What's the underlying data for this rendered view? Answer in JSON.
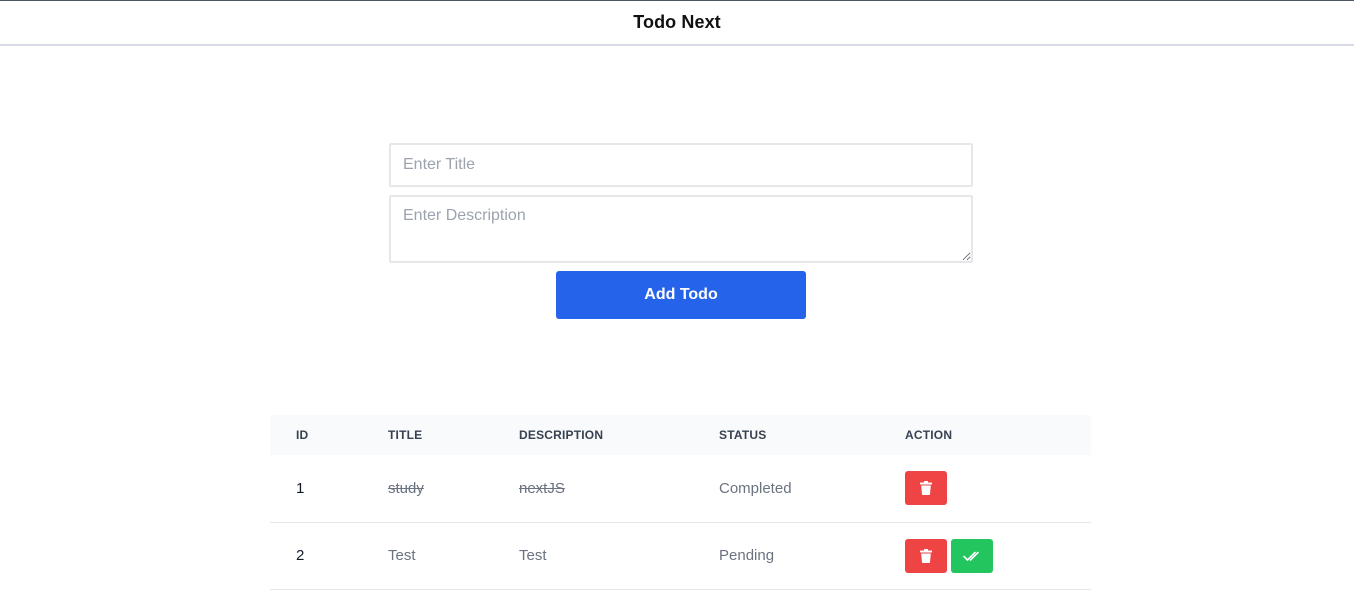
{
  "app": {
    "title": "Todo Next"
  },
  "form": {
    "title_placeholder": "Enter Title",
    "title_value": "",
    "description_placeholder": "Enter Description",
    "description_value": "",
    "submit_label": "Add Todo"
  },
  "table": {
    "headers": [
      "ID",
      "TITLE",
      "DESCRIPTION",
      "STATUS",
      "ACTION"
    ],
    "rows": [
      {
        "id": "1",
        "title": "study",
        "description": "nextJS",
        "status": "Completed",
        "actions": [
          "trash-icon"
        ]
      },
      {
        "id": "2",
        "title": "Test",
        "description": "Test",
        "status": "Pending",
        "actions": [
          "trash-icon",
          "double-check-icon"
        ]
      }
    ]
  },
  "colors": {
    "primary": "#2563eb",
    "danger": "#ef4444",
    "success": "#22c55e",
    "header_bg": "#f9fafb"
  }
}
